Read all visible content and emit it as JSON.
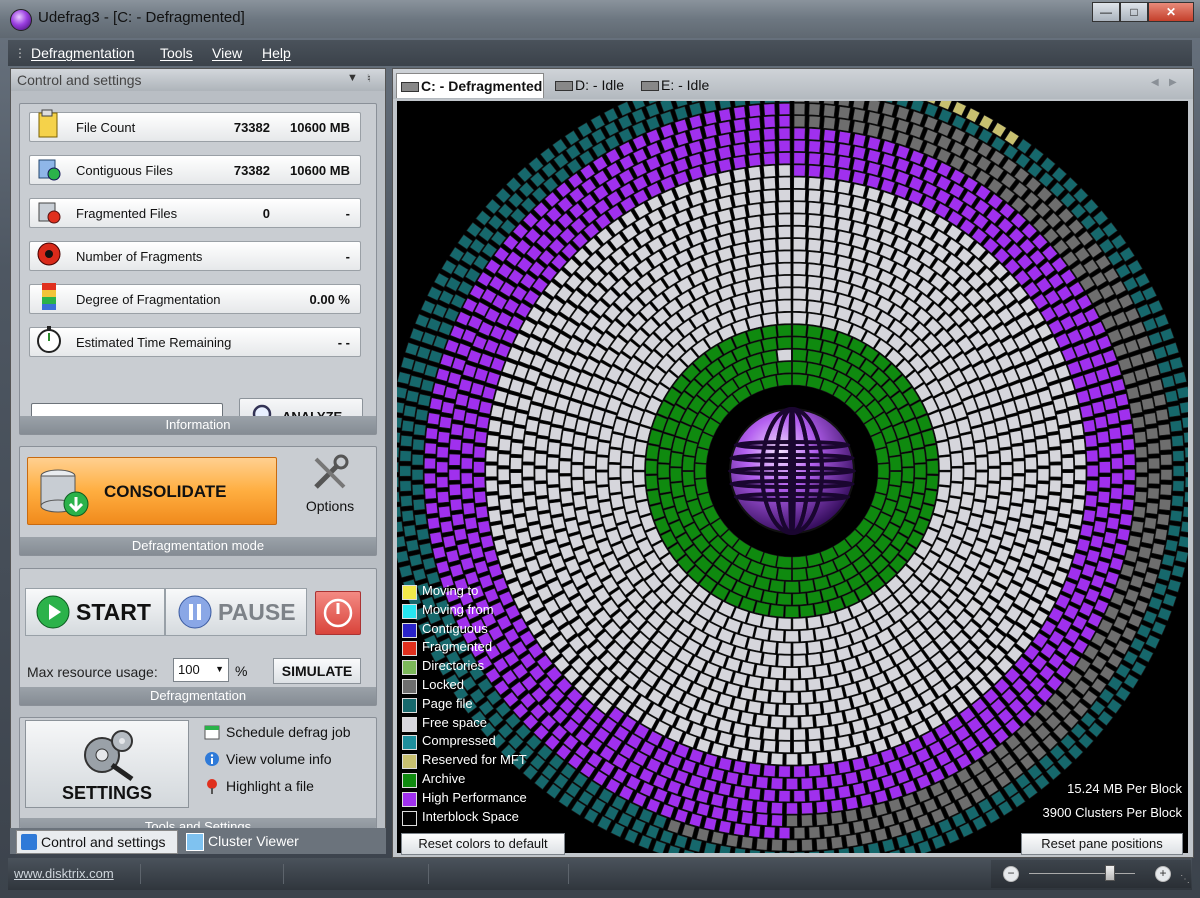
{
  "window": {
    "title": "Udefrag3 - [C: - Defragmented]"
  },
  "menu": [
    "Defragmentation",
    "Tools",
    "View",
    "Help"
  ],
  "left_panel": {
    "title": "Control and settings",
    "information": {
      "footer": "Information",
      "stats": [
        {
          "label": "File Count",
          "count": "73382",
          "size": "10600 MB",
          "icon": "file-count-icon"
        },
        {
          "label": "Contiguous Files",
          "count": "73382",
          "size": "10600 MB",
          "icon": "contiguous-files-icon"
        },
        {
          "label": "Fragmented Files",
          "count": "0",
          "size": "-",
          "icon": "fragmented-files-icon"
        },
        {
          "label": "Number of Fragments",
          "count": "",
          "size": "-",
          "icon": "fragments-icon"
        },
        {
          "label": "Degree of Fragmentation",
          "count": "",
          "size": "0.00 %",
          "icon": "fragmentation-degree-icon"
        },
        {
          "label": "Estimated Time Remaining",
          "count": "",
          "size": "- -",
          "icon": "stopwatch-icon"
        }
      ],
      "analyze_label": "ANALYZE",
      "input_value": ""
    },
    "mode": {
      "consolidate_label": "CONSOLIDATE",
      "options_label": "Options",
      "footer": "Defragmentation mode"
    },
    "defrag": {
      "start_label": "START",
      "pause_label": "PAUSE",
      "resource_label": "Max resource usage:",
      "resource_value": "100",
      "resource_unit": "%",
      "simulate_label": "SIMULATE",
      "footer": "Defragmentation"
    },
    "tools": {
      "settings_label": "SETTINGS",
      "links": [
        {
          "label": "Schedule defrag job",
          "icon": "calendar-icon"
        },
        {
          "label": "View volume info",
          "icon": "info-icon"
        },
        {
          "label": "Highlight a file",
          "icon": "pin-icon"
        }
      ],
      "footer": "Tools and Settings"
    },
    "tabs": [
      "Control and settings",
      "Cluster Viewer"
    ]
  },
  "drive_tabs": [
    {
      "label": "C: - Defragmented",
      "active": true
    },
    {
      "label": "D: - Idle",
      "active": false
    },
    {
      "label": "E: - Idle",
      "active": false
    }
  ],
  "legend": [
    {
      "label": "Moving to",
      "color": "#f2e84a"
    },
    {
      "label": "Moving from",
      "color": "#27e6f0"
    },
    {
      "label": "Contiguous",
      "color": "#2a23c8"
    },
    {
      "label": "Fragmented",
      "color": "#e0301e"
    },
    {
      "label": "Directories",
      "color": "#7cb85a"
    },
    {
      "label": "Locked",
      "color": "#6e6e6e"
    },
    {
      "label": "Page file",
      "color": "#16686c"
    },
    {
      "label": "Free space",
      "color": "#d6d6dc"
    },
    {
      "label": "Compressed",
      "color": "#1e8e9c"
    },
    {
      "label": "Reserved for MFT",
      "color": "#c8c070"
    },
    {
      "label": "Archive",
      "color": "#0f8a0f"
    },
    {
      "label": "High Performance",
      "color": "#a030ee"
    },
    {
      "label": "Interblock Space",
      "color": "#000000"
    }
  ],
  "disk_info": {
    "per_block_mb": "15.24 MB Per Block",
    "per_block_clusters": "3900 Clusters Per Block"
  },
  "buttons": {
    "reset_colors": "Reset colors to default",
    "reset_panes": "Reset pane positions"
  },
  "status": {
    "link": "www.disktrix.com"
  },
  "disk_rings": [
    {
      "ring": 1,
      "segments": [
        [
          "archive",
          1.0
        ]
      ]
    },
    {
      "ring": 2,
      "segments": [
        [
          "archive",
          1.0
        ]
      ]
    },
    {
      "ring": 3,
      "segments": [
        [
          "archive",
          0.97
        ],
        [
          "free",
          0.03
        ]
      ]
    },
    {
      "ring": 4,
      "segments": [
        [
          "archive",
          1.0
        ]
      ]
    },
    {
      "ring": 5,
      "segments": [
        [
          "archive",
          1.0
        ]
      ]
    },
    {
      "ring": 6,
      "segments": [
        [
          "free",
          1.0
        ]
      ]
    },
    {
      "ring": 7,
      "segments": [
        [
          "free",
          1.0
        ]
      ]
    },
    {
      "ring": 8,
      "segments": [
        [
          "free",
          1.0
        ]
      ]
    },
    {
      "ring": 9,
      "segments": [
        [
          "free",
          1.0
        ]
      ]
    },
    {
      "ring": 10,
      "segments": [
        [
          "free",
          1.0
        ]
      ]
    },
    {
      "ring": 11,
      "segments": [
        [
          "free",
          1.0
        ]
      ]
    },
    {
      "ring": 12,
      "segments": [
        [
          "free",
          1.0
        ]
      ]
    },
    {
      "ring": 13,
      "segments": [
        [
          "free",
          1.0
        ]
      ]
    },
    {
      "ring": 14,
      "segments": [
        [
          "free",
          1.0
        ]
      ]
    },
    {
      "ring": 15,
      "segments": [
        [
          "free",
          1.0
        ]
      ]
    },
    {
      "ring": 16,
      "segments": [
        [
          "free",
          1.0
        ]
      ]
    },
    {
      "ring": 17,
      "segments": [
        [
          "free",
          1.0
        ]
      ]
    },
    {
      "ring": 18,
      "segments": [
        [
          "highperf",
          0.6
        ],
        [
          "free",
          0.4
        ]
      ]
    },
    {
      "ring": 19,
      "segments": [
        [
          "highperf",
          1.0
        ]
      ]
    },
    {
      "ring": 20,
      "segments": [
        [
          "highperf",
          1.0
        ]
      ]
    },
    {
      "ring": 21,
      "segments": [
        [
          "highperf",
          1.0
        ]
      ]
    },
    {
      "ring": 22,
      "segments": [
        [
          "locked",
          0.5
        ],
        [
          "highperf",
          0.5
        ]
      ]
    },
    {
      "ring": 23,
      "segments": [
        [
          "locked",
          0.5
        ],
        [
          "highperf",
          0.5
        ]
      ]
    },
    {
      "ring": 24,
      "segments": [
        [
          "locked",
          0.55
        ],
        [
          "pagefile",
          0.45
        ]
      ]
    },
    {
      "ring": 25,
      "segments": [
        [
          "contiguous",
          0.02
        ],
        [
          "pagefile",
          0.98
        ]
      ]
    },
    {
      "ring": 26,
      "segments": [
        [
          "contiguous",
          0.04
        ],
        [
          "mft",
          0.05
        ],
        [
          "pagefile",
          0.91
        ]
      ]
    }
  ]
}
